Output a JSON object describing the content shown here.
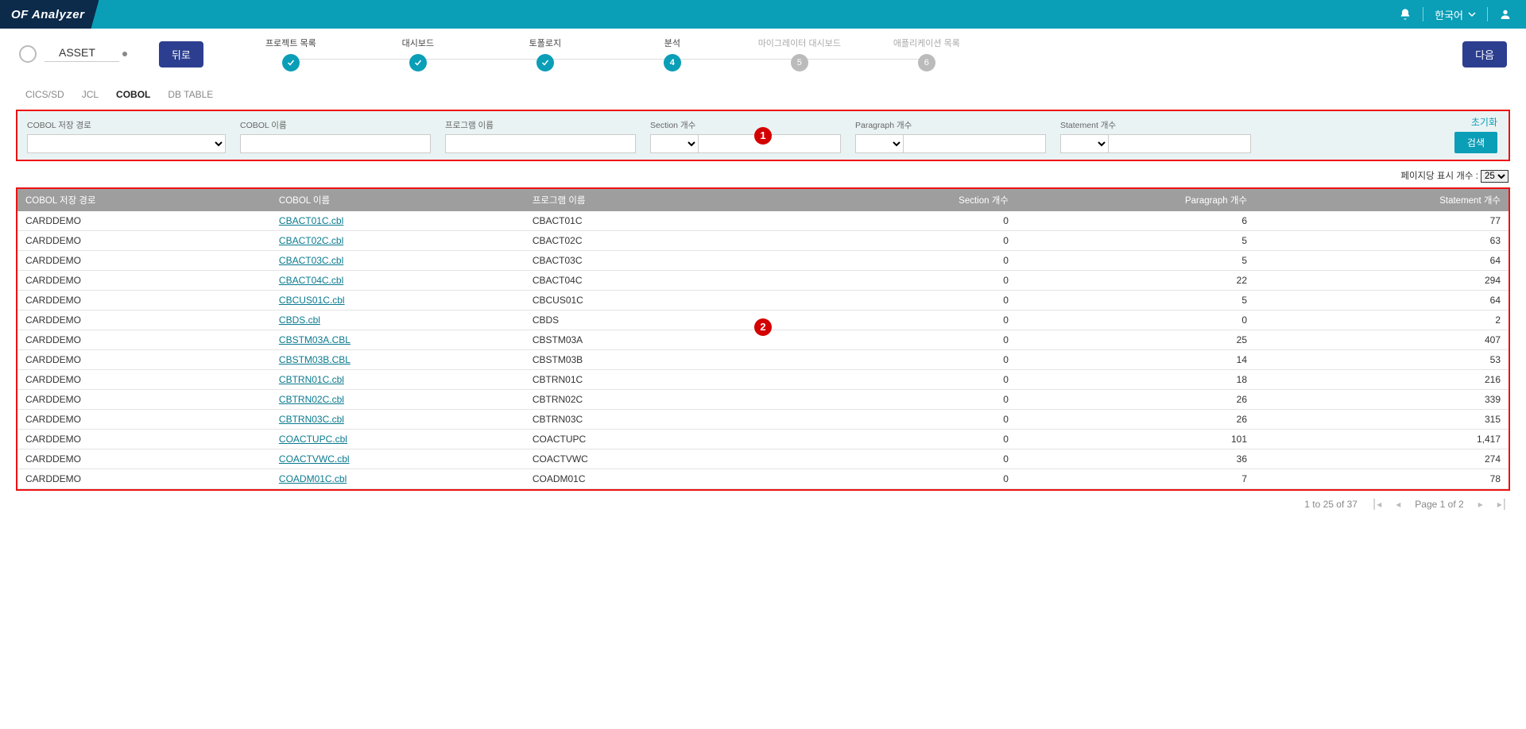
{
  "app": {
    "brand": "OF Analyzer",
    "language": "한국어"
  },
  "stepbar": {
    "asset": "ASSET",
    "back": "뒤로",
    "next": "다음",
    "steps": [
      {
        "label": "프로젝트 목록",
        "state": "done"
      },
      {
        "label": "대시보드",
        "state": "done"
      },
      {
        "label": "토폴로지",
        "state": "done"
      },
      {
        "label": "분석",
        "state": "current",
        "num": "4"
      },
      {
        "label": "마이그레이터 대시보드",
        "state": "pending",
        "num": "5"
      },
      {
        "label": "애플리케이션 목록",
        "state": "pending",
        "num": "6"
      }
    ]
  },
  "tabs": {
    "items": [
      "CICS/SD",
      "JCL",
      "COBOL",
      "DB TABLE"
    ],
    "activeIndex": 2
  },
  "filter": {
    "labels": {
      "path": "COBOL 저장 경로",
      "name": "COBOL 이름",
      "program": "프로그램 이름",
      "section": "Section 개수",
      "paragraph": "Paragraph 개수",
      "statement": "Statement 개수"
    },
    "reset": "초기화",
    "search": "검색"
  },
  "annotations": {
    "one": "1",
    "two": "2"
  },
  "pagesize": {
    "label": "페이지당 표시 개수 :",
    "value": "25"
  },
  "table": {
    "headers": {
      "path": "COBOL 저장 경로",
      "name": "COBOL 이름",
      "program": "프로그램 이름",
      "section": "Section 개수",
      "paragraph": "Paragraph 개수",
      "statement": "Statement 개수"
    },
    "rows": [
      {
        "path": "CARDDEMO",
        "name": "CBACT01C.cbl",
        "program": "CBACT01C",
        "section": 0,
        "paragraph": 6,
        "statement": "77"
      },
      {
        "path": "CARDDEMO",
        "name": "CBACT02C.cbl",
        "program": "CBACT02C",
        "section": 0,
        "paragraph": 5,
        "statement": "63"
      },
      {
        "path": "CARDDEMO",
        "name": "CBACT03C.cbl",
        "program": "CBACT03C",
        "section": 0,
        "paragraph": 5,
        "statement": "64"
      },
      {
        "path": "CARDDEMO",
        "name": "CBACT04C.cbl",
        "program": "CBACT04C",
        "section": 0,
        "paragraph": 22,
        "statement": "294"
      },
      {
        "path": "CARDDEMO",
        "name": "CBCUS01C.cbl",
        "program": "CBCUS01C",
        "section": 0,
        "paragraph": 5,
        "statement": "64"
      },
      {
        "path": "CARDDEMO",
        "name": "CBDS.cbl",
        "program": "CBDS",
        "section": 0,
        "paragraph": 0,
        "statement": "2"
      },
      {
        "path": "CARDDEMO",
        "name": "CBSTM03A.CBL",
        "program": "CBSTM03A",
        "section": 0,
        "paragraph": 25,
        "statement": "407"
      },
      {
        "path": "CARDDEMO",
        "name": "CBSTM03B.CBL",
        "program": "CBSTM03B",
        "section": 0,
        "paragraph": 14,
        "statement": "53"
      },
      {
        "path": "CARDDEMO",
        "name": "CBTRN01C.cbl",
        "program": "CBTRN01C",
        "section": 0,
        "paragraph": 18,
        "statement": "216"
      },
      {
        "path": "CARDDEMO",
        "name": "CBTRN02C.cbl",
        "program": "CBTRN02C",
        "section": 0,
        "paragraph": 26,
        "statement": "339"
      },
      {
        "path": "CARDDEMO",
        "name": "CBTRN03C.cbl",
        "program": "CBTRN03C",
        "section": 0,
        "paragraph": 26,
        "statement": "315"
      },
      {
        "path": "CARDDEMO",
        "name": "COACTUPC.cbl",
        "program": "COACTUPC",
        "section": 0,
        "paragraph": 101,
        "statement": "1,417"
      },
      {
        "path": "CARDDEMO",
        "name": "COACTVWC.cbl",
        "program": "COACTVWC",
        "section": 0,
        "paragraph": 36,
        "statement": "274"
      },
      {
        "path": "CARDDEMO",
        "name": "COADM01C.cbl",
        "program": "COADM01C",
        "section": 0,
        "paragraph": 7,
        "statement": "78"
      }
    ]
  },
  "pager": {
    "summary": "1 to 25 of 37",
    "page": "Page 1 of 2"
  }
}
